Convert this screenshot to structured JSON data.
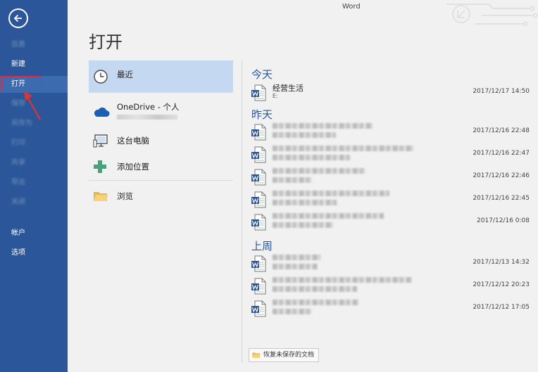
{
  "app": {
    "title": "Word"
  },
  "page": {
    "title": "打开"
  },
  "sidebar": {
    "items": [
      {
        "label": "信息",
        "state": "faded"
      },
      {
        "label": "新建",
        "state": "normal"
      },
      {
        "label": "打开",
        "state": "active"
      },
      {
        "label": "保存",
        "state": "faded"
      },
      {
        "label": "另存为",
        "state": "faded"
      },
      {
        "label": "打印",
        "state": "faded"
      },
      {
        "label": "共享",
        "state": "faded"
      },
      {
        "label": "导出",
        "state": "faded"
      },
      {
        "label": "关闭",
        "state": "faded"
      },
      {
        "label": "帐户",
        "state": "normal"
      },
      {
        "label": "选项",
        "state": "normal"
      }
    ]
  },
  "places": {
    "recent": "最近",
    "onedrive": "OneDrive - 个人",
    "this_pc": "这台电脑",
    "add_place": "添加位置",
    "browse": "浏览"
  },
  "recent": {
    "groups": [
      {
        "label": "今天",
        "files": [
          {
            "name": "经营生活",
            "path": "E:",
            "date": "2017/12/17 14:50"
          }
        ]
      },
      {
        "label": "昨天",
        "files": [
          {
            "date": "2017/12/16 22:48"
          },
          {
            "date": "2017/12/16 22:47"
          },
          {
            "date": "2017/12/16 22:46"
          },
          {
            "date": "2017/12/16 22:45"
          },
          {
            "date": "2017/12/16 0:08"
          }
        ]
      },
      {
        "label": "上周",
        "files": [
          {
            "date": "2017/12/13 14:32"
          },
          {
            "date": "2017/12/12 20:23"
          },
          {
            "date": "2017/12/12 17:05"
          }
        ]
      }
    ]
  },
  "recover": {
    "label": "恢复未保存的文档"
  },
  "colors": {
    "sidebar": "#2b579a",
    "accent": "#2b579a",
    "selected": "#c5d8f1",
    "highlight": "#e23333"
  }
}
